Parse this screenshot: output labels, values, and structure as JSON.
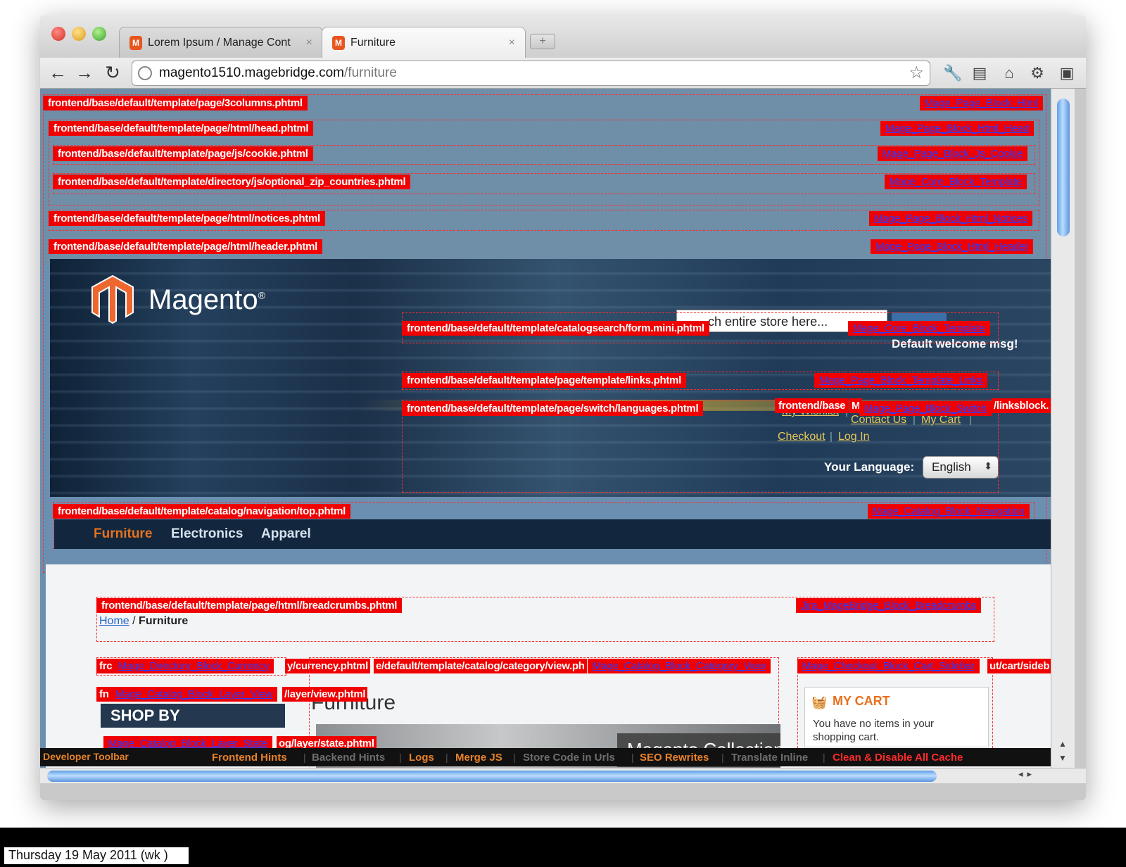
{
  "browser": {
    "tabs": [
      {
        "label": "Lorem Ipsum / Manage Cont",
        "close": "×"
      },
      {
        "label": "Furniture",
        "close": "×"
      }
    ],
    "new_tab": "+",
    "url_host": "magento1510.magebridge.com",
    "url_path": "/furniture",
    "nav": {
      "back": "←",
      "forward": "→",
      "reload": "↻"
    }
  },
  "hints": [
    {
      "path": "frontend/base/default/template/page/3columns.phtml",
      "block": "Mage_Page_Block_Html"
    },
    {
      "path": "frontend/base/default/template/page/html/head.phtml",
      "block": "Mage_Page_Block_Html_Head"
    },
    {
      "path": "frontend/base/default/template/page/js/cookie.phtml",
      "block": "Mage_Page_Block_Js_Cookie"
    },
    {
      "path": "frontend/base/default/template/directory/js/optional_zip_countries.phtml",
      "block": "Mage_Core_Block_Template"
    },
    {
      "path": "frontend/base/default/template/page/html/notices.phtml",
      "block": "Mage_Page_Block_Html_Notices"
    },
    {
      "path": "frontend/base/default/template/page/html/header.phtml",
      "block": "Mage_Page_Block_Html_Header"
    },
    {
      "path": "frontend/base/default/template/catalogsearch/form.mini.phtml",
      "block": "Mage_Core_Block_Template"
    },
    {
      "path": "frontend/base/default/template/page/template/links.phtml",
      "block": "Mage_Page_Block_Template_Links"
    },
    {
      "path": "frontend/base/default/template/page/switch/languages.phtml",
      "block": "Mage_Page_Block_Switch"
    },
    {
      "path": "frontend/base/default/template/catalog/navigation/top.phtml",
      "block": "Mage_Catalog_Block_Navigation"
    },
    {
      "path": "frontend/base/default/template/page/html/breadcrumbs.phtml",
      "block": "Jira_MageBridge_Block_Breadcrumbs"
    }
  ],
  "hint_fragments": {
    "links_left": "frontend/base",
    "links_m": "M",
    "links_right": "/linksblock.",
    "currency_left": "frc",
    "currency_block": "Mage_Directory_Block_Currency",
    "currency_path": "y/currency.phtml",
    "category_path": "e/default/template/catalog/category/view.ph",
    "category_block": "Mage_Catalog_Block_Category_View",
    "cart_block": "Mage_Checkout_Block_Cart_Sidebar",
    "cart_path": "ut/cart/sideb",
    "layer_left": "fn",
    "layer_block": "Mage_Catalog_Block_Layer_View",
    "layer_path": "/layer/view.phtml",
    "state_block": "Mage_Catalog_Block_Layer_State",
    "state_path": "og/layer/state.phtml"
  },
  "store": {
    "brand": "Magento",
    "brand_mark": "®",
    "search_placeholder": "ch entire store here...",
    "welcome": "Default welcome msg!",
    "links": [
      "My Wishlist",
      "Contact Us",
      "My Cart",
      "Checkout",
      "Log In"
    ],
    "link_sep": "|",
    "language_label": "Your Language:",
    "language_value": "English",
    "nav": [
      {
        "label": "Furniture",
        "color": "#e8711d"
      },
      {
        "label": "Electronics",
        "color": "#d6e2ee"
      },
      {
        "label": "Apparel",
        "color": "#d6e2ee"
      }
    ],
    "breadcrumb_home": "Home",
    "breadcrumb_sep": "/",
    "breadcrumb_current": "Furniture",
    "category_title": "Furniture",
    "shop_by": "SHOP BY",
    "banner_text": "Magento Collection",
    "cart_title": "MY CART",
    "cart_empty": "You have no items in your shopping cart."
  },
  "dev_toolbar": {
    "title": "Developer Toolbar",
    "items": [
      {
        "label": "Frontend Hints",
        "color": "#e8822a"
      },
      {
        "label": "Backend Hints",
        "color": "#6d6d6d"
      },
      {
        "label": "Logs",
        "color": "#e8822a"
      },
      {
        "label": "Merge JS",
        "color": "#e8822a"
      },
      {
        "label": "Store Code in Urls",
        "color": "#6d6d6d"
      },
      {
        "label": "SEO Rewrites",
        "color": "#e8822a"
      },
      {
        "label": "Translate Inline",
        "color": "#6d6d6d"
      },
      {
        "label": "Clean & Disable All Cache",
        "color": "#ff2a2a"
      }
    ]
  },
  "os": {
    "date": "Thursday 19 May 2011 (wk )"
  }
}
